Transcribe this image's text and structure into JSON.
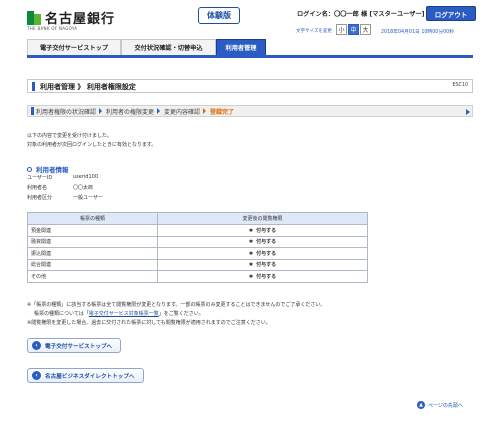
{
  "header": {
    "bank_name": "名古屋銀行",
    "bank_sub": "THE BANK OF NAGOYA",
    "trial_badge": "体験版",
    "login_name": "ログイン名：〇〇一郎 様 [マスターユーザー]",
    "logout_label": "ログアウト",
    "font_size_label": "文字サイズを変更",
    "font_sizes": [
      "小",
      "中",
      "大"
    ],
    "font_size_selected": "中",
    "datetime": "2018年04月01日 10時00分00秒"
  },
  "tabs": [
    {
      "label": "電子交付サービストップ"
    },
    {
      "label": "交付状況確認・切替申込"
    },
    {
      "label": "利用者管理",
      "active": true
    }
  ],
  "page": {
    "title": "利用者管理 》 利用者権限設定",
    "screen_id": "ESC10"
  },
  "steps": [
    {
      "label": "利用者権限の状況確認"
    },
    {
      "label": "利用者の権限変更"
    },
    {
      "label": "変更内容確認"
    },
    {
      "label": "登録完了",
      "current": true
    }
  ],
  "messages": [
    "以下の内容で変更を受け付けました。",
    "対象の利用者が次回ログインしたときに有効となります。"
  ],
  "user_info": {
    "section_title": "利用者情報",
    "rows": [
      {
        "key": "ユーザーID",
        "value": "userid100"
      },
      {
        "key": "利用者名",
        "value": "〇〇太郎"
      },
      {
        "key": "利用者区分",
        "value": "一般ユーザー"
      }
    ]
  },
  "table": {
    "headers": [
      "帳票の種類",
      "変更後の閲覧権限"
    ],
    "rows": [
      {
        "type": "預金関連",
        "perm_mark": "✱",
        "perm": "付与する"
      },
      {
        "type": "融資関連",
        "perm_mark": "✱",
        "perm": "付与する"
      },
      {
        "type": "振込関連",
        "perm_mark": "✱",
        "perm": "付与する"
      },
      {
        "type": "総合関連",
        "perm_mark": "✱",
        "perm": "付与する"
      },
      {
        "type": "その他",
        "perm_mark": "✱",
        "perm": "付与する"
      }
    ]
  },
  "notes": {
    "line1": "※「帳票の種類」に該当する帳票は全て閲覧権限が変更となります。一部の帳票のみ変更することはできませんのでご了承ください。",
    "line2_prefix": "帳票の種類については「",
    "line2_link": "電子交付サービス対象帳票一覧",
    "line2_suffix": "」をご覧ください。",
    "line3": "※閲覧権限を変更した場合、過去に交付された帳票に対しても閲覧権限が適用されますのでご注意ください。"
  },
  "buttons": {
    "top": "電子交付サービストップへ",
    "bizdirect": "名古屋ビジネスダイレクトトップへ"
  },
  "pagetop": "ページの先頭へ"
}
